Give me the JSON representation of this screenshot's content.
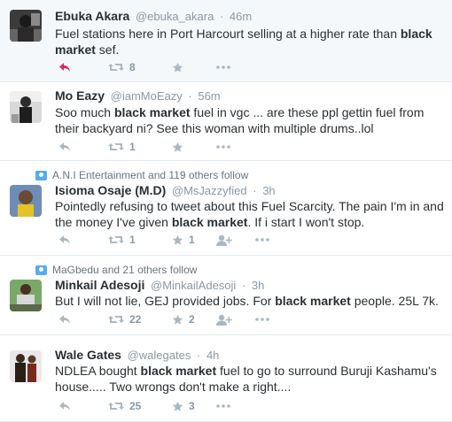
{
  "tweets": [
    {
      "name": "Ebuka Akara",
      "handle": "@ebuka_akara",
      "time": "46m",
      "text_parts": [
        "Fuel stations here in Port Harcourt selling at a higher rate than ",
        "black market",
        " sef."
      ],
      "retweets": "8",
      "favorites": "",
      "reply_active_color": "#e0245e"
    },
    {
      "name": "Mo Eazy",
      "handle": "@iamMoEazy",
      "time": "56m",
      "text_parts": [
        "Soo much ",
        "black market",
        " fuel in vgc ... are these ppl gettin fuel from their backyard ni? See this woman with multiple drums..lol"
      ],
      "retweets": "1",
      "favorites": ""
    },
    {
      "context": "A.N.I Entertainment and 119 others follow",
      "name": "Isioma Osaje (M.D)",
      "handle": "@MsJazzyfied",
      "time": "3h",
      "text_parts": [
        "Pointedly refusing to tweet about this Fuel Scarcity. The pain I'm in and the money I've given ",
        "black market",
        ". If i start I won't stop."
      ],
      "retweets": "1",
      "favorites": "1"
    },
    {
      "context": "MaGbedu and 21 others follow",
      "name": "Minkail Adesoji",
      "handle": "@MinkailAdesoji",
      "time": "3h",
      "text_parts": [
        "But I will not lie, GEJ provided jobs. For ",
        "black market",
        " people. 25L 7k."
      ],
      "retweets": "22",
      "favorites": "2"
    },
    {
      "name": "Wale Gates",
      "handle": "@walegates",
      "time": "4h",
      "text_parts": [
        "NDLEA bought ",
        "black market",
        " fuel to go to surround Buruji Kashamu's house..... Two wrongs don't make a right...."
      ],
      "retweets": "25",
      "favorites": "3"
    }
  ],
  "separator": "·",
  "icons": {
    "reply": "reply-icon",
    "retweet": "retweet-icon",
    "favorite": "star-icon",
    "follow": "follow-icon",
    "more": "more-dots-icon",
    "context": "people-icon"
  },
  "colors": {
    "icon_gray": "#aab8c2",
    "name": "#292f33",
    "meta": "#8899a6",
    "context_icon": "#55acee",
    "reply_active": "#e0245e",
    "highlight_bg": "#f5f8fa"
  }
}
